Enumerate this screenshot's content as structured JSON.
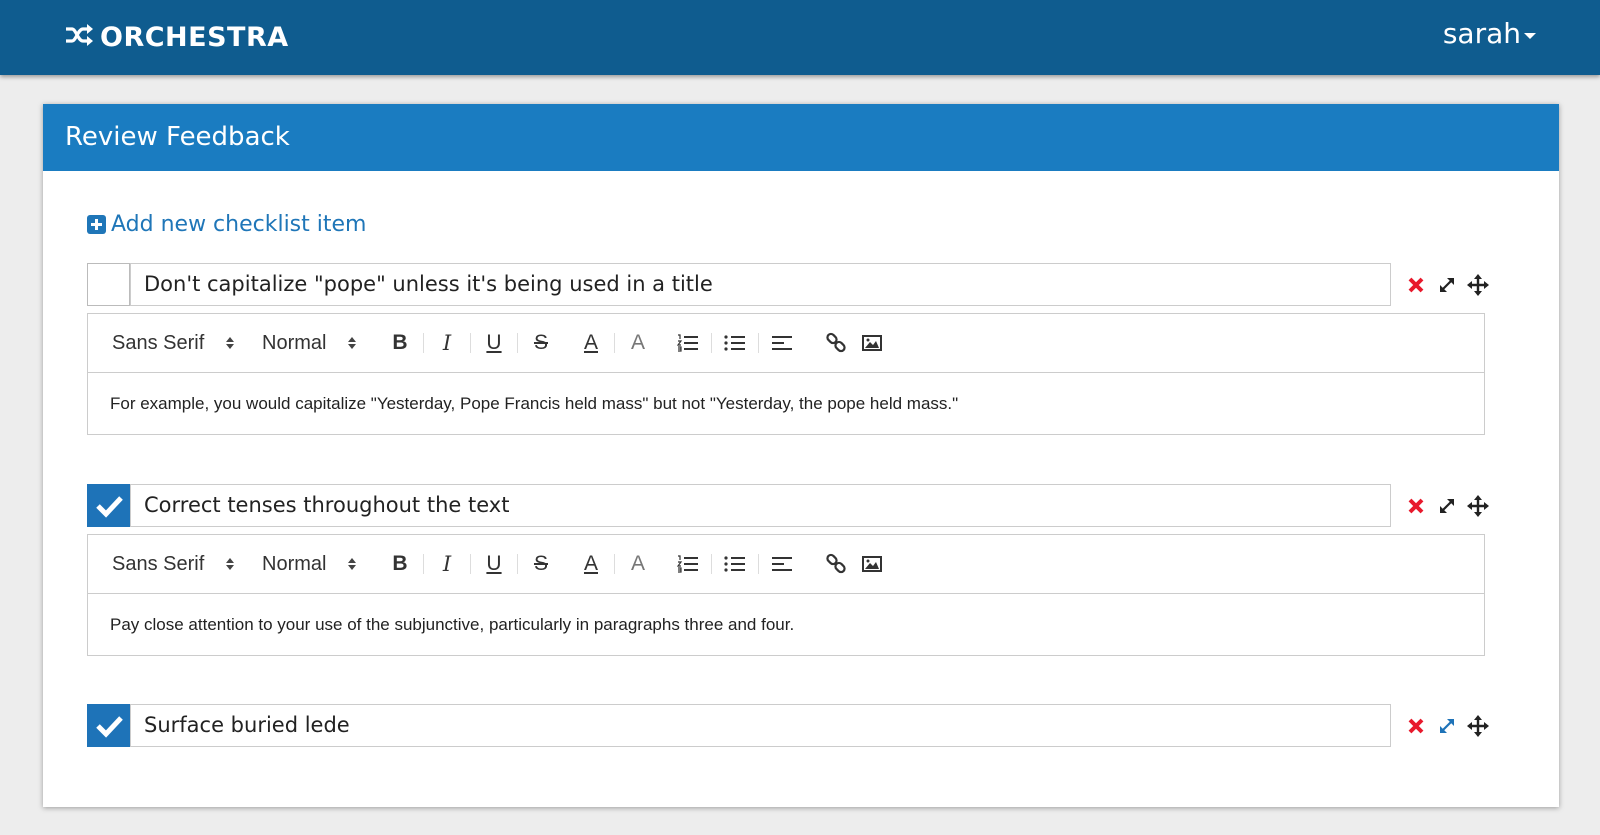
{
  "app": {
    "brand": "ORCHESTRA",
    "user": "sarah"
  },
  "panel": {
    "title": "Review Feedback",
    "add_label": "Add new checklist item"
  },
  "toolbar": {
    "font": "Sans Serif",
    "size": "Normal",
    "bold": "B",
    "italic": "I",
    "underline": "U",
    "strike": "S",
    "color": "A",
    "background": "A"
  },
  "items": [
    {
      "title": "Don't capitalize \"pope\" unless it's being used in a title",
      "checked": false,
      "body": "For example, you would capitalize \"Yesterday, Pope Francis held mass\" but not \"Yesterday, the pope held mass.\""
    },
    {
      "title": "Correct tenses throughout the text",
      "checked": true,
      "body": "Pay close attention to your use of the subjunctive, particularly in paragraphs three and four."
    },
    {
      "title": "Surface buried lede",
      "checked": true
    }
  ],
  "colors": {
    "navbar": "#0f5c8f",
    "panel_header": "#1a7cc1",
    "accent": "#1e73b8",
    "delete": "#e8192c"
  }
}
